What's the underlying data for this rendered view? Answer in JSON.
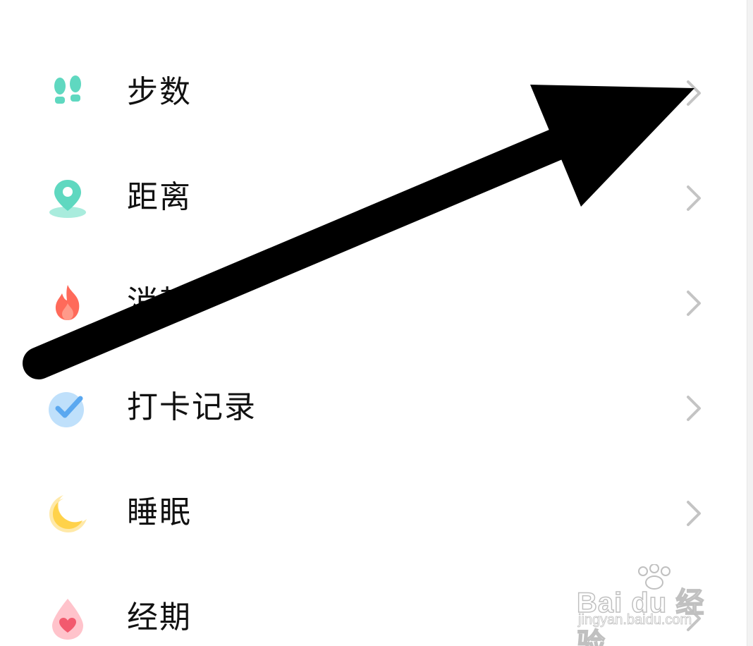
{
  "menu": {
    "items": [
      {
        "label": "步数",
        "icon": "footprints-icon"
      },
      {
        "label": "距离",
        "icon": "location-pin-icon"
      },
      {
        "label": "消耗",
        "icon": "flame-icon"
      },
      {
        "label": "打卡记录",
        "icon": "checkmark-icon"
      },
      {
        "label": "睡眠",
        "icon": "moon-icon"
      },
      {
        "label": "经期",
        "icon": "heart-drop-icon"
      }
    ]
  },
  "watermark": {
    "brand": "Bai du 经验",
    "url": "jingyan.baidu.com"
  },
  "colors": {
    "teal": "#5fd8c0",
    "flame": "#ff6a5a",
    "check_blue": "#5aa8f0",
    "moon_yellow": "#ffd24a",
    "drop_pink": "#ff9aa8",
    "chevron": "#c4c4c4",
    "annotation_arrow": "#000000"
  }
}
